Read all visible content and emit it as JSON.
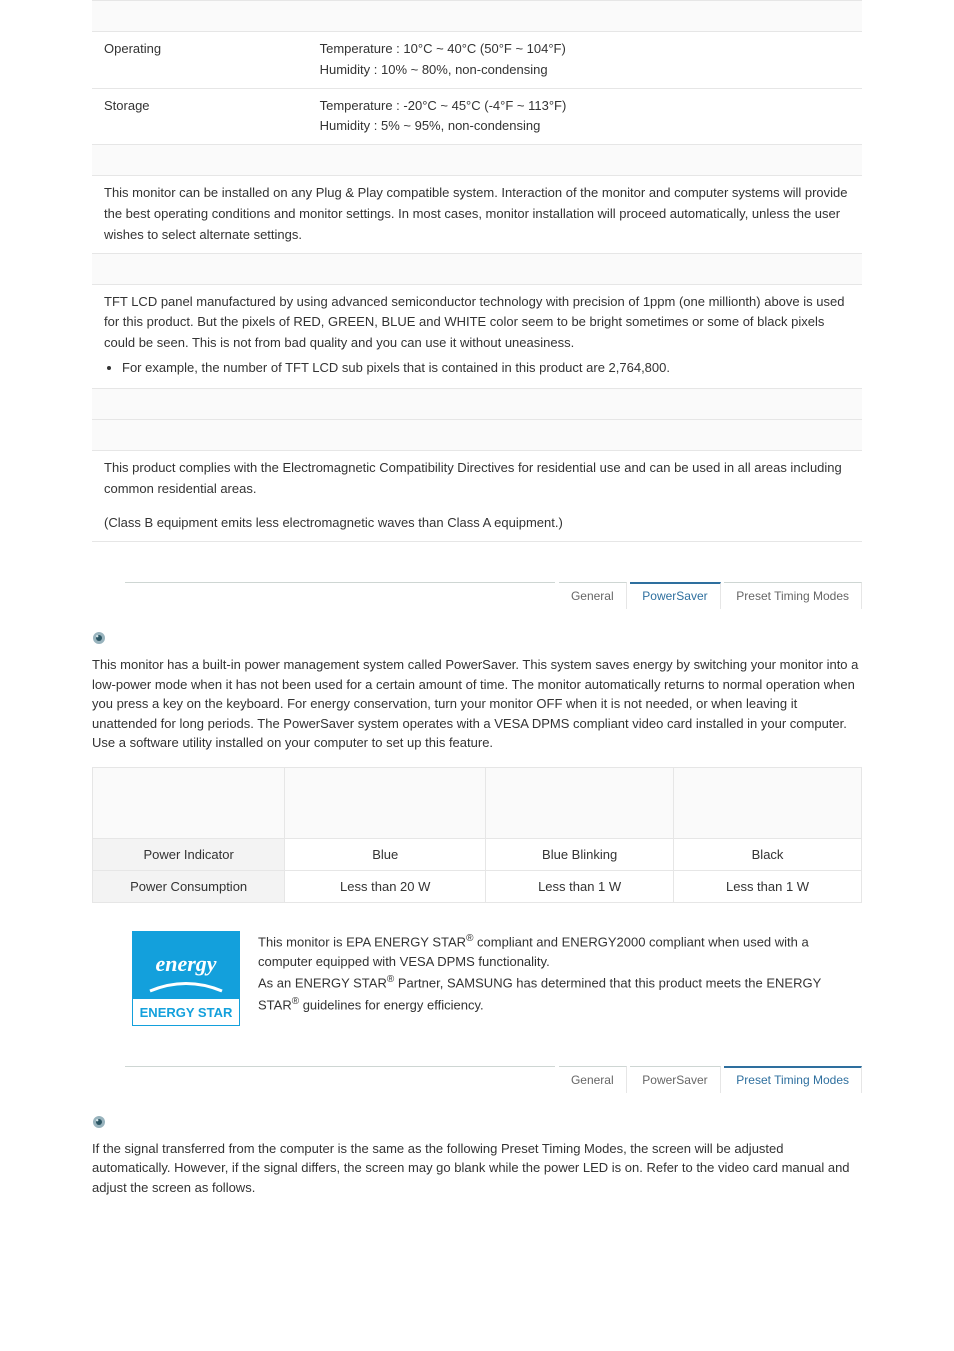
{
  "spec": {
    "operating_label": "Operating",
    "operating_value": "Temperature : 10°C ~ 40°C (50°F ~ 104°F)\nHumidity : 10% ~ 80%, non-condensing",
    "storage_label": "Storage",
    "storage_value": "Temperature : -20°C ~ 45°C (-4°F ~ 113°F)\nHumidity : 5% ~ 95%, non-condensing",
    "plug_play": "This monitor can be installed on any Plug & Play compatible system. Interaction of the monitor and computer systems will provide the best operating conditions and monitor settings. In most cases, monitor installation will proceed automatically, unless the user wishes to select alternate settings.",
    "dot_text": "TFT LCD panel manufactured by using advanced semiconductor technology with precision of 1ppm (one millionth) above is used for this product. But the pixels of RED, GREEN, BLUE and WHITE color seem to be bright sometimes or some of black pixels could be seen. This is not from bad quality and you can use it without uneasiness.",
    "dot_bullet": "For example, the number of TFT LCD sub pixels that is contained in this product are 2,764,800.",
    "class_text1": "This product complies with the Electromagnetic Compatibility Directives for residential use and can be used in all areas including common residential areas.",
    "class_text2": "(Class B equipment emits less electromagnetic waves than Class A equipment.)"
  },
  "tabs": {
    "general": "General",
    "powersaver": "PowerSaver",
    "preset": "Preset Timing Modes"
  },
  "powersaver": {
    "intro": "This monitor has a built-in power management system called PowerSaver. This system saves energy by switching your monitor into a low-power mode when it has not been used for a certain amount of time. The monitor automatically returns to normal operation when you press a key on the keyboard. For energy conservation, turn your monitor OFF when it is not needed, or when leaving it unattended for long periods. The PowerSaver system operates with a VESA DPMS compliant video card installed in your computer. Use a software utility installed on your computer to set up this feature.",
    "row1_label": "Power Indicator",
    "row1_c1": "Blue",
    "row1_c2": "Blue Blinking",
    "row1_c3": "Black",
    "row2_label": "Power Consumption",
    "row2_c1": "Less than 20 W",
    "row2_c2": "Less than 1 W",
    "row2_c3": "Less than 1 W",
    "energy_p1a": "This monitor is EPA ENERGY STAR",
    "energy_p1b": " compliant and ENERGY2000 compliant when used with a computer equipped with VESA DPMS functionality.",
    "energy_p2a": "As an ENERGY STAR",
    "energy_p2b": " Partner, SAMSUNG has determined that this product meets the ENERGY STAR",
    "energy_p2c": " guidelines for energy efficiency.",
    "reg": "®",
    "logo_brand": "energy",
    "logo_label": "ENERGY STAR"
  },
  "preset": {
    "intro": "If the signal transferred from the computer is the same as the following Preset Timing Modes, the screen will be adjusted automatically. However, if the signal differs, the screen may go blank while the power LED is on. Refer to the video card manual and adjust the screen as follows."
  },
  "colors": {
    "accent_blue": "#2e6f9e",
    "energy_blue": "#13a0dc"
  }
}
